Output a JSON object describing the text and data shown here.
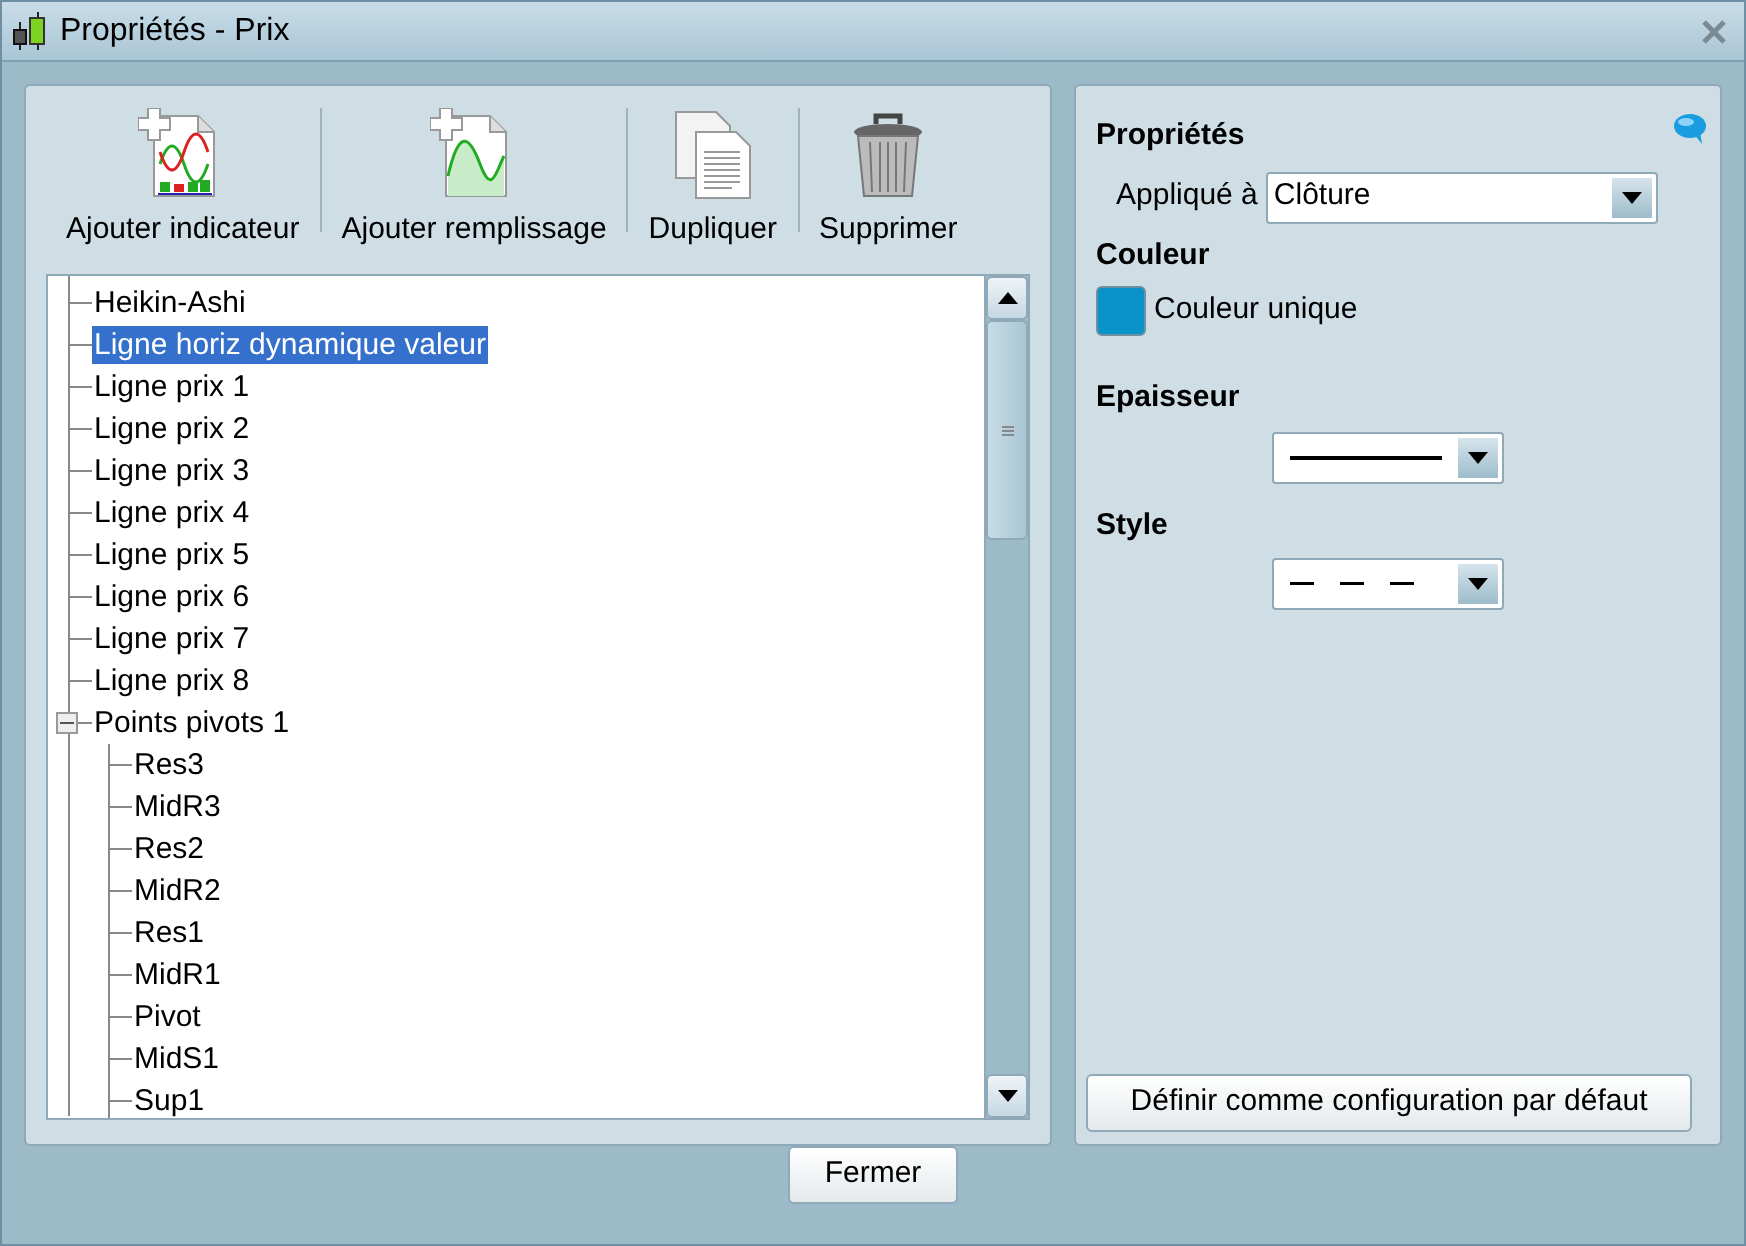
{
  "window": {
    "title": "Propriétés - Prix"
  },
  "toolbar": [
    {
      "label": "Ajouter indicateur",
      "kind": "add-indicator"
    },
    {
      "label": "Ajouter remplissage",
      "kind": "add-fill"
    },
    {
      "label": "Dupliquer",
      "kind": "duplicate"
    },
    {
      "label": "Supprimer",
      "kind": "delete"
    }
  ],
  "tree": [
    {
      "label": "Heikin-Ashi",
      "selected": false
    },
    {
      "label": "Ligne horiz dynamique valeur",
      "selected": true
    },
    {
      "label": "Ligne prix 1",
      "selected": false
    },
    {
      "label": "Ligne prix 2",
      "selected": false
    },
    {
      "label": "Ligne prix 3",
      "selected": false
    },
    {
      "label": "Ligne prix 4",
      "selected": false
    },
    {
      "label": "Ligne prix 5",
      "selected": false
    },
    {
      "label": "Ligne prix 6",
      "selected": false
    },
    {
      "label": "Ligne prix 7",
      "selected": false
    },
    {
      "label": "Ligne prix 8",
      "selected": false
    },
    {
      "label": "Points pivots 1",
      "selected": false,
      "expanded": true,
      "children": [
        {
          "label": "Res3",
          "selected": false
        },
        {
          "label": "MidR3",
          "selected": false
        },
        {
          "label": "Res2",
          "selected": false
        },
        {
          "label": "MidR2",
          "selected": false
        },
        {
          "label": "Res1",
          "selected": false
        },
        {
          "label": "MidR1",
          "selected": false
        },
        {
          "label": "Pivot",
          "selected": false
        },
        {
          "label": "MidS1",
          "selected": false
        },
        {
          "label": "Sup1",
          "selected": false
        }
      ]
    }
  ],
  "properties": {
    "heading": "Propriétés",
    "applied_label": "Appliqué à",
    "applied_value": "Clôture",
    "color_heading": "Couleur",
    "color_label": "Couleur unique",
    "color": "#0a93c8",
    "thickness_heading": "Epaisseur",
    "style_heading": "Style",
    "default_button": "Définir comme configuration par défaut"
  },
  "close_button": "Fermer"
}
